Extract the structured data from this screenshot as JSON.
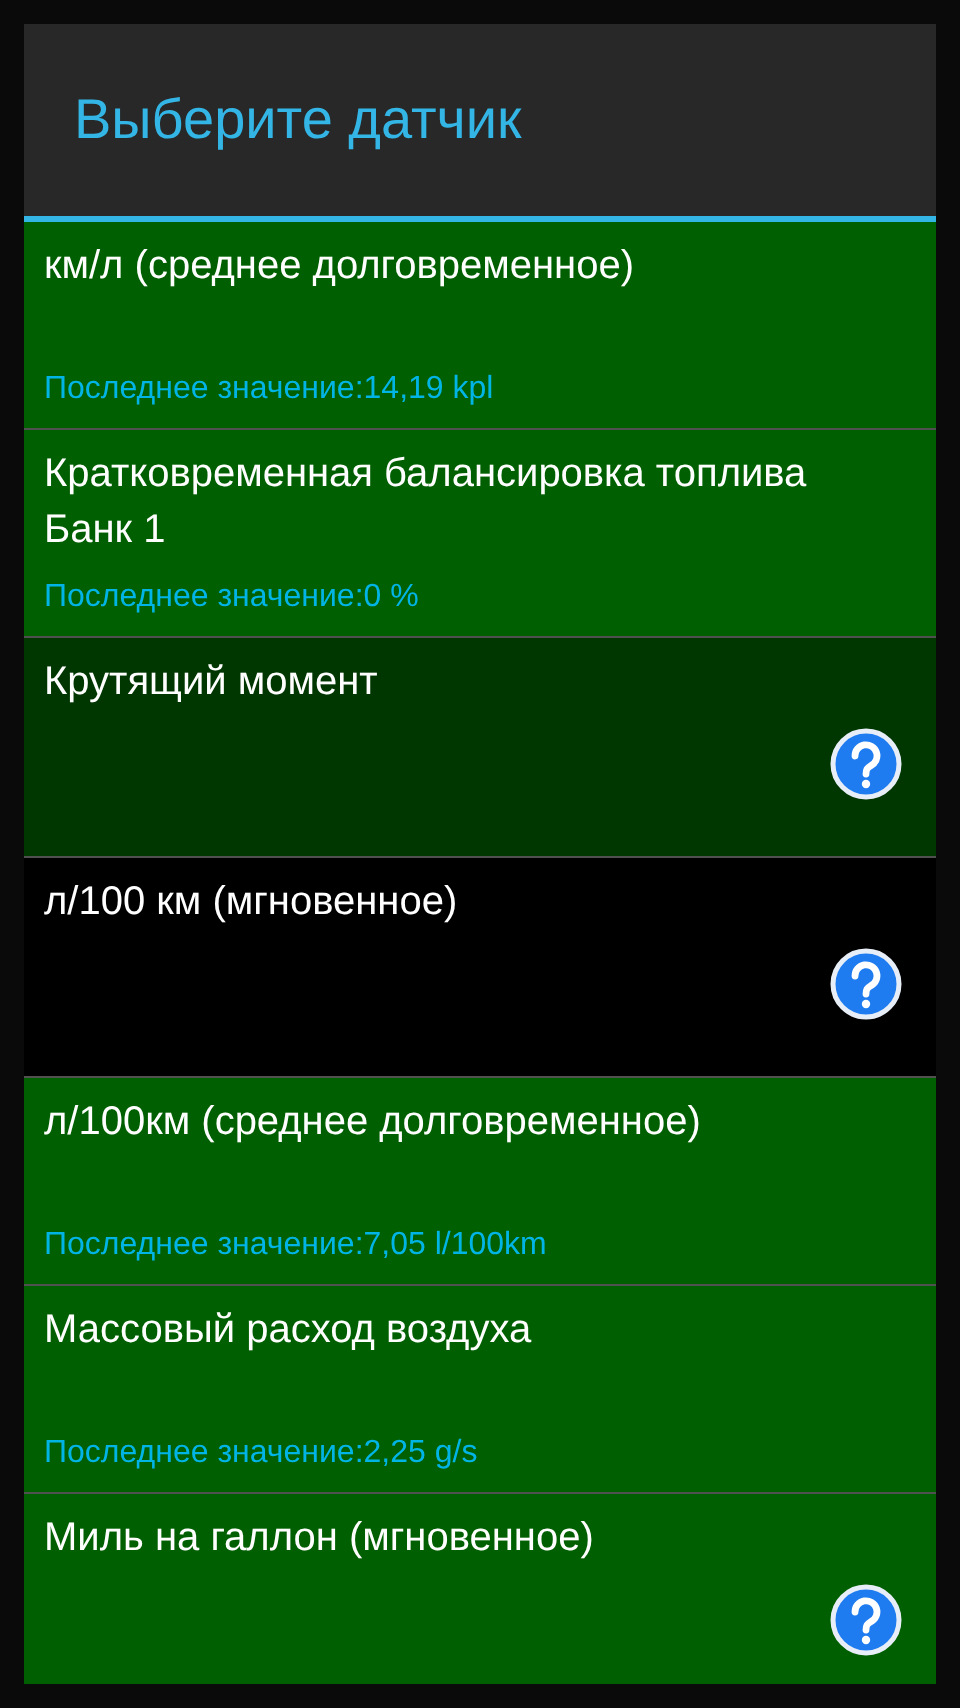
{
  "dialog": {
    "title": "Выберите датчик"
  },
  "sensors": [
    {
      "name": "км/л (среднее долговременное)",
      "last_value": "Последнее значение:14,19 kpl",
      "color": "#005f00",
      "help": false
    },
    {
      "name": "Кратковременная балансировка топлива Банк 1",
      "last_value": "Последнее значение:0 %",
      "color": "#005f00",
      "help": false
    },
    {
      "name": "Крутящий момент",
      "color": "#003700",
      "help": true
    },
    {
      "name": "л/100 км (мгновенное)",
      "color": "#000000",
      "help": true
    },
    {
      "name": "л/100км (среднее долговременное)",
      "last_value": "Последнее значение:7,05 l/100km",
      "color": "#005f00",
      "help": false
    },
    {
      "name": "Массовый расход воздуха",
      "last_value": "Последнее значение:2,25 g/s",
      "color": "#005f00",
      "help": false
    },
    {
      "name": "Миль на галлон (мгновенное)",
      "color": "#005f00",
      "help": true
    }
  ]
}
